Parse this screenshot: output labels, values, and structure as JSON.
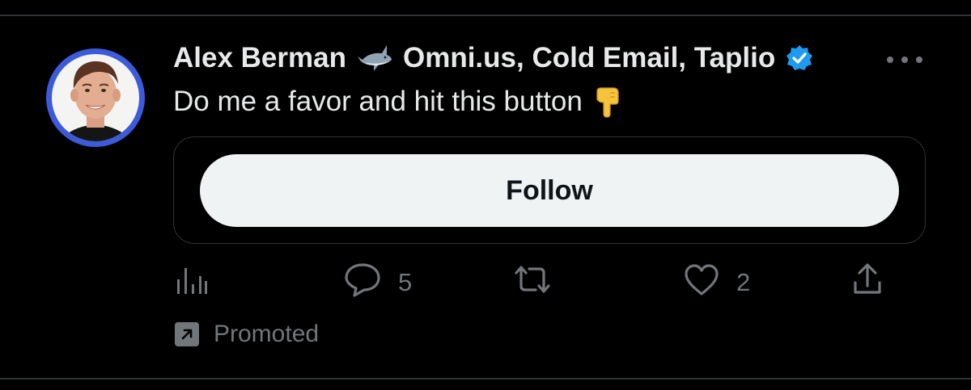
{
  "tweet": {
    "author_name": "Alex Berman",
    "author_affiliations": "Omni.us, Cold Email, Taplio",
    "text": "Do me a favor and hit this button",
    "card": {
      "button_label": "Follow"
    },
    "actions": {
      "replies": "5",
      "likes": "2"
    },
    "promoted_label": "Promoted"
  },
  "colors": {
    "background": "#000000",
    "verified_badge": "#1d9bf0",
    "secondary_text": "#71767b",
    "follow_button_bg": "#eff3f4",
    "avatar_ring": "#3b5bdb"
  },
  "icons": {
    "name_emoji": "shark-icon",
    "text_emoji": "pointing-down-hand-icon",
    "verified": "verified-badge-icon",
    "more": "more-options-icon",
    "analytics": "analytics-icon",
    "reply": "reply-icon",
    "retweet": "retweet-icon",
    "like": "heart-icon",
    "share": "share-icon",
    "promoted": "promoted-arrow-icon"
  }
}
